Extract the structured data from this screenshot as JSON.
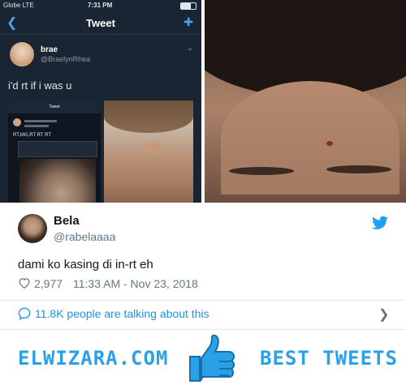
{
  "embedded_screenshot": {
    "status": {
      "carrier": "Globe  LTE",
      "time": "7:31 PM"
    },
    "nav": {
      "title": "Tweet"
    },
    "inner_tweet": {
      "name": "brae",
      "handle": "@BraelynRhea",
      "text": "i'd rt if i was u"
    },
    "nested": {
      "bar_title": "Tweet",
      "text": "RT,MG,RT RT RT"
    }
  },
  "tweet": {
    "display_name": "Bela",
    "handle": "@rabelaaaa",
    "text": "dami ko kasing di in-rt eh",
    "like_count": "2,977",
    "timestamp": "11:33 AM - Nov 23, 2018",
    "talking": "11.8K people are talking about this"
  },
  "banner": {
    "site": "ELWIZARA.COM",
    "tagline": "BEST TWEETS"
  },
  "colors": {
    "twitter_blue": "#1da1f2",
    "link_blue": "#1b95e0",
    "banner_blue": "#2aa0e6"
  },
  "icons": [
    "back-arrow-icon",
    "compose-icon",
    "twitter-bird-icon",
    "heart-icon",
    "speech-bubble-icon",
    "chevron-right-icon",
    "thumbs-up-icon"
  ]
}
